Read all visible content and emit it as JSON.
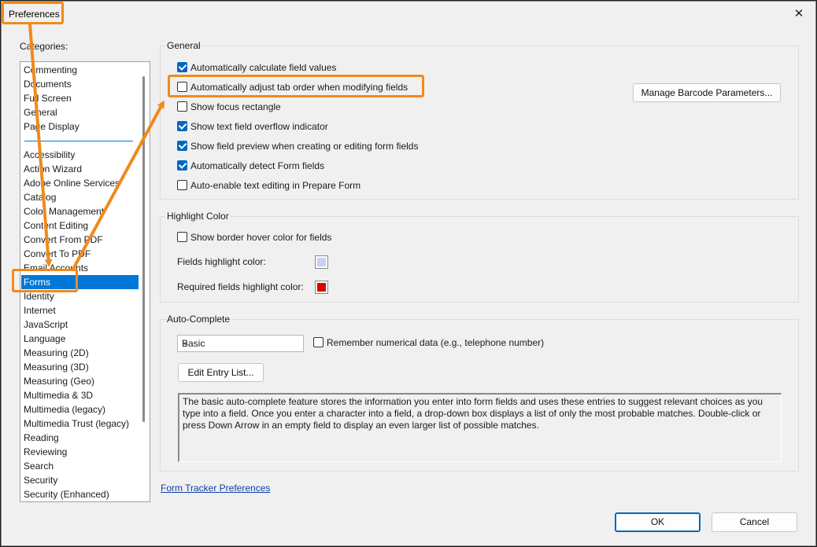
{
  "window": {
    "title": "Preferences",
    "close_glyph": "✕"
  },
  "categories": {
    "label": "Categories:",
    "top_items": [
      "Commenting",
      "Documents",
      "Full Screen",
      "General",
      "Page Display"
    ],
    "items": [
      "Accessibility",
      "Action Wizard",
      "Adobe Online Services",
      "Catalog",
      "Color Management",
      "Content Editing",
      "Convert From PDF",
      "Convert To PDF",
      "Email Accounts",
      "Forms",
      "Identity",
      "Internet",
      "JavaScript",
      "Language",
      "Measuring (2D)",
      "Measuring (3D)",
      "Measuring (Geo)",
      "Multimedia & 3D",
      "Multimedia (legacy)",
      "Multimedia Trust (legacy)",
      "Reading",
      "Reviewing",
      "Search",
      "Security",
      "Security (Enhanced)"
    ],
    "selected": "Forms"
  },
  "general": {
    "title": "General",
    "options": [
      {
        "label": "Automatically calculate field values",
        "checked": true
      },
      {
        "label": "Automatically adjust tab order when modifying fields",
        "checked": false
      },
      {
        "label": "Show focus rectangle",
        "checked": false
      },
      {
        "label": "Show text field overflow indicator",
        "checked": true
      },
      {
        "label": "Show field preview when creating or editing form fields",
        "checked": true
      },
      {
        "label": "Automatically detect Form fields",
        "checked": true
      },
      {
        "label": "Auto-enable text editing in Prepare Form",
        "checked": false
      }
    ],
    "barcode_button": "Manage Barcode Parameters..."
  },
  "highlight": {
    "title": "Highlight Color",
    "hover_option": {
      "label": "Show border hover color for fields",
      "checked": false
    },
    "fields_label": "Fields highlight color:",
    "fields_color": "#c8d0f8",
    "required_label": "Required fields highlight color:",
    "required_color": "#e00000"
  },
  "autocomplete": {
    "title": "Auto-Complete",
    "mode_value": "Basic",
    "remember_option": {
      "label": "Remember numerical data (e.g., telephone number)",
      "checked": false
    },
    "edit_button": "Edit Entry List...",
    "description": "The basic auto-complete feature stores the information you enter into form fields and uses these entries to suggest relevant choices as you type into a field. Once you enter a character into a field, a drop-down box displays a list of only the most probable matches. Double-click or press Down Arrow in an empty field to display an even larger list of possible matches."
  },
  "footer": {
    "tracker_link": "Form Tracker Preferences",
    "ok": "OK",
    "cancel": "Cancel"
  },
  "colors": {
    "accent": "#0078d7",
    "callout": "#f08a1c"
  }
}
